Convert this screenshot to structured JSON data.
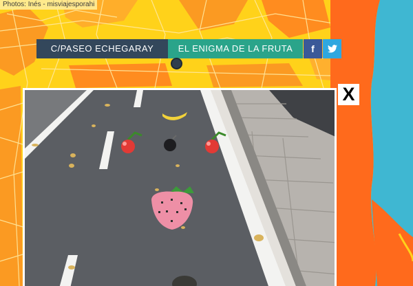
{
  "photo_credit": "Photos: Inés - misviajesporahi",
  "header": {
    "street_label": "C/PASEO ECHEGARAY",
    "title": "EL ENIGMA DE LA FRUTA",
    "facebook_glyph": "f"
  },
  "close_label": "X",
  "colors": {
    "map_yellow": "#ffd21a",
    "map_orange": "#fb9a22",
    "sea_orange": "#ff6a1c",
    "sea_blue": "#3fb7d2",
    "street_bg": "#33475b",
    "title_bg": "#2aa48a",
    "facebook": "#3b5998",
    "twitter": "#2fa7e0"
  },
  "icons": [
    "facebook-icon",
    "twitter-icon",
    "map-pin-icon",
    "close-icon"
  ]
}
